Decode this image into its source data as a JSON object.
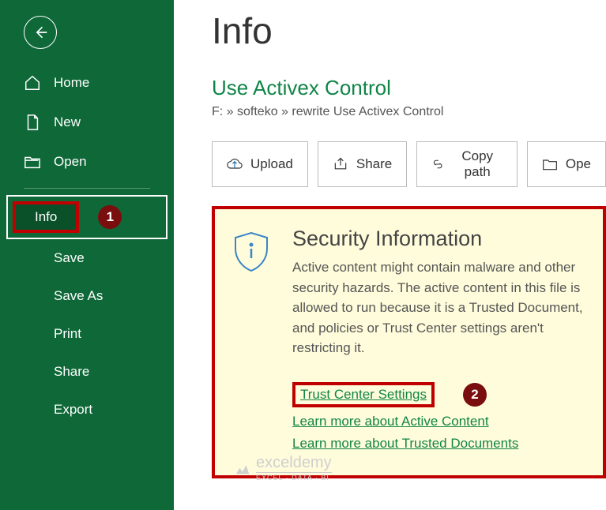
{
  "sidebar": {
    "home": "Home",
    "new": "New",
    "open": "Open",
    "info": "Info",
    "save": "Save",
    "saveas": "Save As",
    "print": "Print",
    "share": "Share",
    "export": "Export"
  },
  "badges": {
    "one": "1",
    "two": "2"
  },
  "main": {
    "title": "Info",
    "doc_title": "Use Activex Control",
    "breadcrumb": "F: » softeko » rewrite Use Activex Control"
  },
  "toolbar": {
    "upload": "Upload",
    "share": "Share",
    "copypath": "Copy path",
    "openloc": "Ope"
  },
  "security": {
    "heading": "Security Information",
    "body": "Active content might contain malware and other security hazards. The active content in this file is allowed to run because it is a Trusted Document, and policies or Trust Center settings aren't restricting it.",
    "link_trust": "Trust Center Settings",
    "link_active": "Learn more about Active Content",
    "link_docs": "Learn more about Trusted Documents"
  },
  "watermark": {
    "main": "exceldemy",
    "sub": "EXCEL · DATA · BI"
  }
}
